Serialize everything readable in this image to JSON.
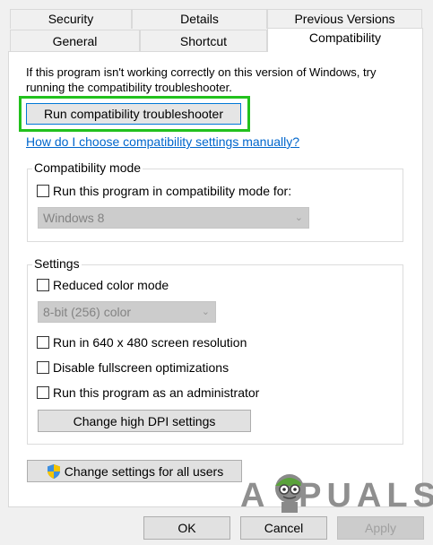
{
  "tabs": {
    "row1": [
      "Security",
      "Details",
      "Previous Versions"
    ],
    "row2": [
      "General",
      "Shortcut",
      "Compatibility"
    ],
    "active": "Compatibility"
  },
  "intro": {
    "line1": "If this program isn't working correctly on this version of Windows, try",
    "line2": "running the compatibility troubleshooter."
  },
  "troubleshooter_button": "Run compatibility troubleshooter",
  "help_link": "How do I choose compatibility settings manually?",
  "compat_mode": {
    "legend": "Compatibility mode",
    "checkbox": "Run this program in compatibility mode for:",
    "checked": false,
    "select_value": "Windows 8"
  },
  "settings": {
    "legend": "Settings",
    "reduced_color": "Reduced color mode",
    "color_select": "8-bit (256) color",
    "res_640": "Run in 640 x 480 screen resolution",
    "disable_fullscreen": "Disable fullscreen optimizations",
    "run_admin": "Run this program as an administrator",
    "dpi_button": "Change high DPI settings"
  },
  "all_users_button": "Change settings for all users",
  "watermark": "A  PUALS",
  "footer": {
    "ok": "OK",
    "cancel": "Cancel",
    "apply": "Apply"
  },
  "colors": {
    "highlight": "#22c11d",
    "link": "#0066cc"
  }
}
